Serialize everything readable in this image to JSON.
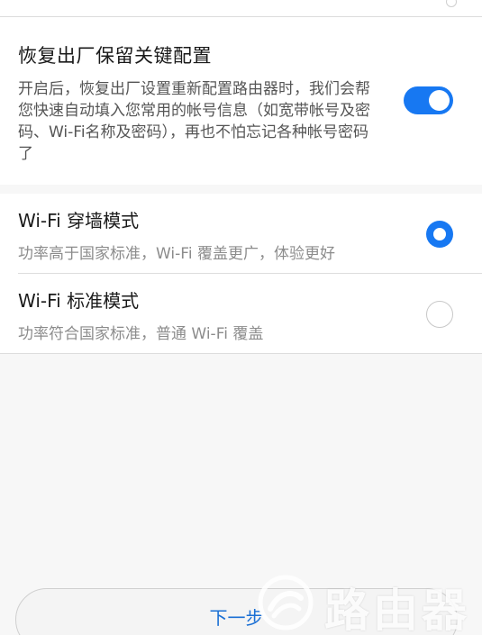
{
  "restore": {
    "title": "恢复出厂保留关键配置",
    "description": "开启后，恢复出厂设置重新配置路由器时，我们会帮您快速自动填入您常用的帐号信息（如宽带帐号及密码、Wi-Fi名称及密码），再也不怕忘记各种帐号密码了",
    "enabled": true
  },
  "modes": [
    {
      "title": "Wi-Fi 穿墙模式",
      "subtitle": "功率高于国家标准，Wi-Fi 覆盖更广，体验更好",
      "selected": true
    },
    {
      "title": "Wi-Fi 标准模式",
      "subtitle": "功率符合国家标准，普通 Wi-Fi 覆盖",
      "selected": false
    }
  ],
  "footer": {
    "next_label": "下一步"
  },
  "watermark": {
    "text": "路由器"
  },
  "colors": {
    "accent": "#1778f2",
    "link": "#1a6fd4"
  }
}
